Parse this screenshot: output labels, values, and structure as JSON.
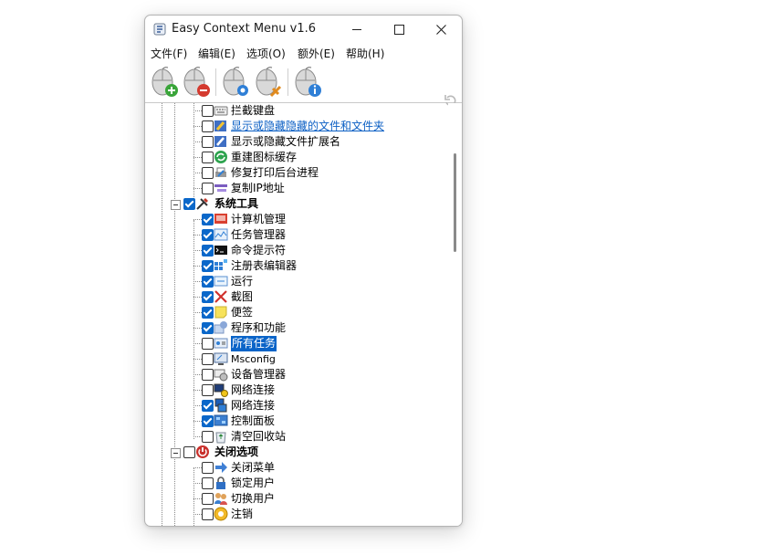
{
  "window": {
    "title": "Easy Context Menu v1.6"
  },
  "menu": [
    "文件(F)",
    "编辑(E)",
    "选项(O)",
    "额外(E)",
    "帮助(H)"
  ],
  "tree": {
    "misc_items": [
      {
        "label": "拦截键盘",
        "checked": false,
        "icon": "keyboard-icon"
      },
      {
        "label": "显示或隐藏隐藏的文件和文件夹",
        "checked": false,
        "icon": "hidden-files-icon",
        "style": "link"
      },
      {
        "label": "显示或隐藏文件扩展名",
        "checked": false,
        "icon": "file-extension-icon"
      },
      {
        "label": "重建图标缓存",
        "checked": false,
        "icon": "rebuild-cache-icon"
      },
      {
        "label": "修复打印后台进程",
        "checked": false,
        "icon": "printer-icon"
      },
      {
        "label": "复制IP地址",
        "checked": false,
        "icon": "ip-address-icon"
      }
    ],
    "system_tools": {
      "label": "系统工具",
      "checked": true,
      "items": [
        {
          "label": "计算机管理",
          "checked": true,
          "icon": "computer-management-icon"
        },
        {
          "label": "任务管理器",
          "checked": true,
          "icon": "task-manager-icon"
        },
        {
          "label": "命令提示符",
          "checked": true,
          "icon": "command-prompt-icon"
        },
        {
          "label": "注册表编辑器",
          "checked": true,
          "icon": "registry-editor-icon"
        },
        {
          "label": "运行",
          "checked": true,
          "icon": "run-icon"
        },
        {
          "label": "截图",
          "checked": true,
          "icon": "snipping-tool-icon"
        },
        {
          "label": "便签",
          "checked": true,
          "icon": "sticky-notes-icon"
        },
        {
          "label": "程序和功能",
          "checked": true,
          "icon": "programs-features-icon"
        },
        {
          "label": "所有任务",
          "checked": false,
          "icon": "all-tasks-icon",
          "style": "selected"
        },
        {
          "label": "Msconfig",
          "checked": false,
          "icon": "msconfig-icon",
          "style": "small"
        },
        {
          "label": "设备管理器",
          "checked": false,
          "icon": "device-manager-icon"
        },
        {
          "label": "网络连接",
          "checked": false,
          "icon": "network-connections-icon"
        },
        {
          "label": "网络连接",
          "checked": true,
          "icon": "network-connections-icon"
        },
        {
          "label": "控制面板",
          "checked": true,
          "icon": "control-panel-icon"
        },
        {
          "label": "清空回收站",
          "checked": false,
          "icon": "recycle-bin-icon"
        }
      ]
    },
    "shutdown_options": {
      "label": "关闭选项",
      "checked": false,
      "items": [
        {
          "label": "关闭菜单",
          "checked": false,
          "icon": "shutdown-menu-icon"
        },
        {
          "label": "锁定用户",
          "checked": false,
          "icon": "lock-icon"
        },
        {
          "label": "切换用户",
          "checked": false,
          "icon": "switch-user-icon"
        },
        {
          "label": "注销",
          "checked": false,
          "icon": "logoff-icon"
        }
      ]
    }
  }
}
